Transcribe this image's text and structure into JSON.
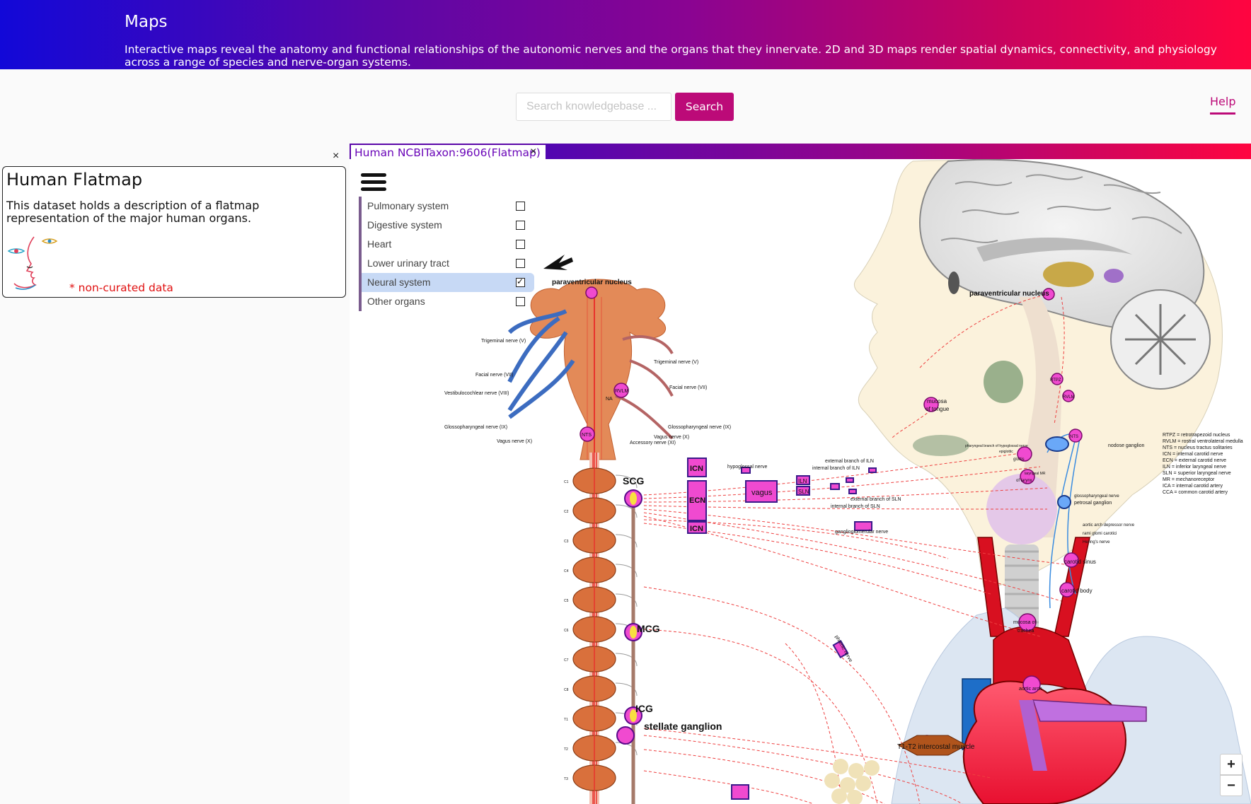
{
  "header": {
    "title": "Maps",
    "description": "Interactive maps reveal the anatomy and functional relationships of the autonomic nerves and the organs that they innervate. 2D and 3D maps render spatial dynamics, connectivity, and physiology across a range of species and nerve-organ systems."
  },
  "search": {
    "placeholder": "Search knowledgebase ...",
    "button_label": "Search"
  },
  "help": {
    "label": "Help"
  },
  "dataset": {
    "close": "×",
    "title": "Human Flatmap",
    "description": "This dataset holds a description of a flatmap representation of the major human organs.",
    "note": "* non-curated data"
  },
  "tabs": [
    {
      "label": "Human NCBITaxon:9606(Flatmap)",
      "close": "×"
    }
  ],
  "layers": [
    {
      "label": "Pulmonary system",
      "checked": false
    },
    {
      "label": "Digestive system",
      "checked": false
    },
    {
      "label": "Heart",
      "checked": false
    },
    {
      "label": "Lower urinary tract",
      "checked": false
    },
    {
      "label": "Neural system",
      "checked": true
    },
    {
      "label": "Other organs",
      "checked": false
    }
  ],
  "zoom": {
    "in": "+",
    "out": "−"
  },
  "map_labels": {
    "paraventricular_left": "paraventricular nucleus",
    "paraventricular_right": "paraventricular nucleus",
    "trigeminal_l": "Trigeminal nerve (V)",
    "trigeminal_r": "Trigeminal nerve (V)",
    "facial_l": "Facial nerve (VII)",
    "facial_r": "Facial nerve (VII)",
    "vestibulo": "Vestibulocochlear nerve (VIII)",
    "glosso_l": "Glossopharyngeal nerve (IX)",
    "glosso_r": "Glossopharyngeal nerve (IX)",
    "vagus_l": "Vagus nerve (X)",
    "vagus_r": "Vagus nerve (X)",
    "accessory": "Accessory nerve (XI)",
    "rvlm": "RVLM",
    "nts": "NTS",
    "na": "NA",
    "scg": "SCG",
    "mcg": "MCG",
    "icg": "ICG",
    "stellate": "stellate ganglion",
    "icn_top": "ICN",
    "ecn": "ECN",
    "icn_bottom": "ICN",
    "vagus_box": "vagus",
    "iln": "ILN",
    "sln": "SLN",
    "hypoglossal": "hypoglossal nerve",
    "ext_iln": "external branch of ILN",
    "int_iln": "internal branch of ILN",
    "ext_sln": "external branch of SLN",
    "int_sln": "internal branch of SLN",
    "gangliogl": "ganglioglomerular nerve",
    "phrenic": "phrenic nerve",
    "mucosa_tongue_1": "mucosa",
    "mucosa_tongue_2": "of tongue",
    "nodose": "nodose ganglion",
    "petrosal": "petrosal ganglion",
    "gloss_nerve_r": "glossopharyngeal nerve",
    "aortic_dep": "aortic arch depressor nerve",
    "rami": "rami glomi carotici",
    "hering": "Hering's nerve",
    "carotid_sinus": "carotid sinus",
    "carotid_body": "carotid body",
    "mucosa_trachea_1": "mucosa of",
    "mucosa_trachea_2": "trachea",
    "aortic_arch": "aortic arch",
    "intercostal": "T1-T2 intercostal muscle",
    "rtpz": "RTPZ",
    "rvlm2": "RVLM",
    "nts2": "NTS",
    "pharyngeal": "pharyngeal branch of hypoglossal nerve",
    "epiglottic": "epiglottic",
    "glottis": "glottis",
    "larynx": "of larynx",
    "laryngeal": "laryngeal MR",
    "legend": [
      "RTPZ = retrotrapezoid nucleus",
      "RVLM = rostral ventrolateral medulla",
      "NTS  = nucleus tractus solitaries",
      "ICN  = internal carotid nerve",
      "ECN  = external carotid nerve",
      "ILN  = inferior laryngeal nerve",
      "SLN  = superior laryngeal nerve",
      "MR   = mechanoreceptor",
      "ICA  = internal carotid artery",
      "CCA  = common carotid artery"
    ],
    "vertebrae": [
      "C1",
      "C2",
      "C3",
      "C4",
      "C5",
      "C6",
      "C7",
      "C8",
      "T1",
      "T2",
      "T3"
    ]
  },
  "colors": {
    "brand": "#bc0a78",
    "error": "#e01010",
    "nerve_red": "#e8322c",
    "node_magenta": "#f04ad0",
    "spine_orange": "#d9703c"
  }
}
